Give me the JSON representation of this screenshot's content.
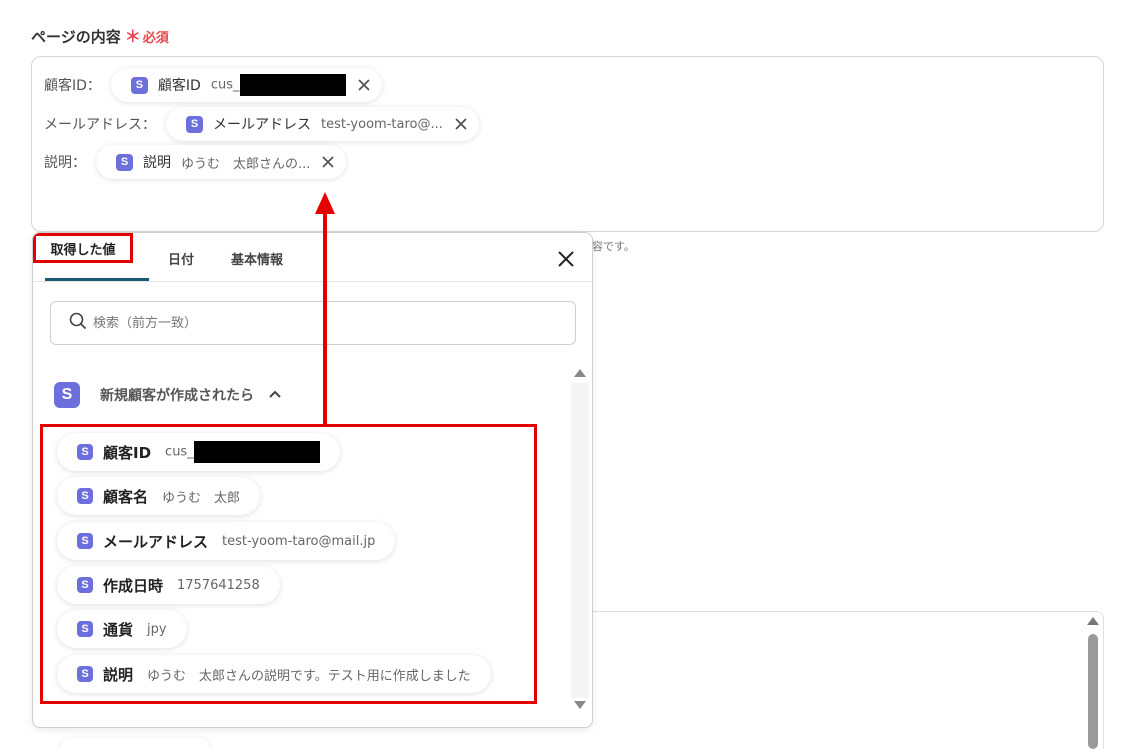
{
  "section": {
    "title": "ページの内容",
    "required_mark": "＊",
    "required_label": "必須"
  },
  "editor": {
    "lines": [
      {
        "label": "顧客ID：",
        "pill_name": "顧客ID",
        "pill_value": "cus_"
      },
      {
        "label": "メールアドレス：",
        "pill_name": "メールアドレス",
        "pill_value": "test-yoom-taro@..."
      },
      {
        "label": "説明：",
        "pill_name": "説明",
        "pill_value": "ゆうむ　太郎さんの..."
      }
    ],
    "badge_letter": "S"
  },
  "hint_text": "容です。",
  "panel": {
    "tabs": [
      {
        "label": "取得した値"
      },
      {
        "label": "日付"
      },
      {
        "label": "基本情報"
      }
    ],
    "search_placeholder": "検索（前方一致）",
    "group": {
      "label": "新規顧客が作成されたら",
      "badge_letter": "S"
    },
    "items": [
      {
        "name": "顧客ID",
        "value": "cus_"
      },
      {
        "name": "顧客名",
        "value": "ゆうむ　太郎"
      },
      {
        "name": "メールアドレス",
        "value": "test-yoom-taro@mail.jp"
      },
      {
        "name": "作成日時",
        "value": "1757641258"
      },
      {
        "name": "通貨",
        "value": "jpy"
      },
      {
        "name": "説明",
        "value": "ゆうむ　太郎さんの説明です。テスト用に作成しました"
      }
    ]
  },
  "colors": {
    "accent_red": "#e50000",
    "stripe_purple": "#6c6fdc",
    "tab_underline": "#1b5a72"
  }
}
